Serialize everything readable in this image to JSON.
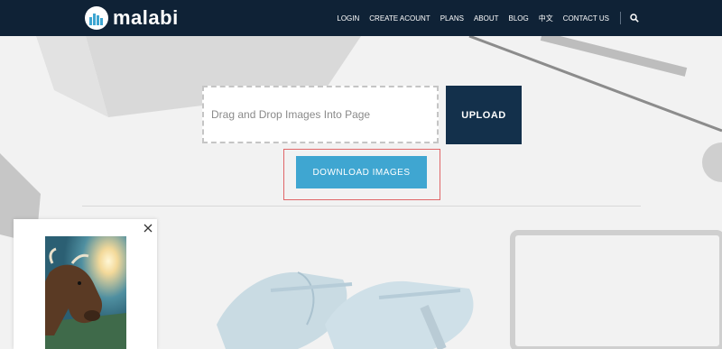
{
  "header": {
    "logo_text": "malabi",
    "nav": [
      "LOGIN",
      "CREATE ACOUNT",
      "PLANS",
      "ABOUT",
      "BLOG",
      "中文",
      "CONTACT US"
    ]
  },
  "upload": {
    "dropzone_text": "Drag and Drop Images Into Page",
    "upload_label": "UPLOAD",
    "download_label": "DOWNLOAD IMAGES"
  },
  "colors": {
    "header_bg": "#0f2236",
    "upload_button": "#13304b",
    "download_button": "#3fa6d1",
    "highlight_border": "#e06668"
  },
  "icons": {
    "logo": "cloud-city-logo-icon",
    "search": "search-icon",
    "close": "close-icon"
  }
}
